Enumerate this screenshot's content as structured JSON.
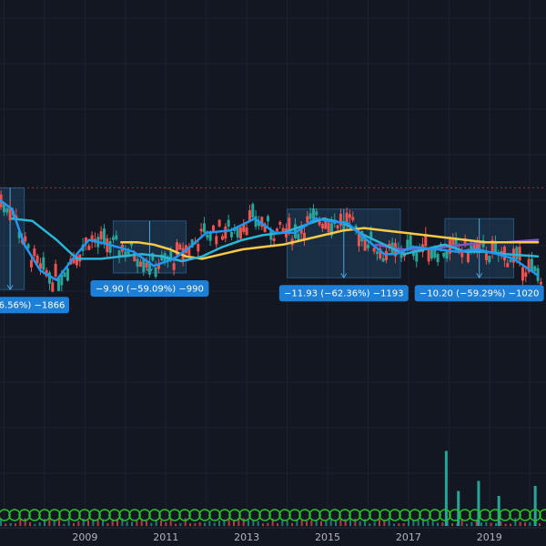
{
  "chart_data": {
    "type": "candlestick",
    "x_tick_labels": [
      "2009",
      "2011",
      "2013",
      "2015",
      "2017",
      "2019"
    ],
    "x_range": [
      2007.0,
      2020.5
    ],
    "y_range_price": [
      0,
      100
    ],
    "grid": true,
    "colors": {
      "background": "#131722",
      "grid": "#1e2230",
      "up": "#26a69a",
      "down": "#ef5350",
      "ma_fast": "#2196f3",
      "ma_mid": "#29b6d8",
      "ma_slow": "#f7c948",
      "ma_long": "#7e57c2",
      "drawdown_box": "#2a6b9c",
      "label_bg": "#1e7fd6",
      "ref_line": "#c0392b",
      "volume": "#26a69a",
      "marker": "#2bbf2b"
    },
    "reference_line": {
      "style": "dotted",
      "value": 86
    },
    "drawdowns": [
      {
        "label": "6.56%) −1866",
        "x_start": 2006.9,
        "x_end": 2007.6,
        "top": 86,
        "bottom": 43
      },
      {
        "label": "−9.90 (−59.09%) −990",
        "x_start": 2009.8,
        "x_end": 2011.6,
        "top": 72,
        "bottom": 50
      },
      {
        "label": "−11.93 (−62.36%) −1193",
        "x_start": 2014.1,
        "x_end": 2016.9,
        "top": 77,
        "bottom": 48
      },
      {
        "label": "−10.20 (−59.29%) −1020",
        "x_start": 2018.0,
        "x_end": 2019.7,
        "top": 73,
        "bottom": 48
      }
    ],
    "series": [
      {
        "type": "ma",
        "x": [
          2006.9,
          2007.3,
          2007.6,
          2008.0,
          2008.4,
          2008.8,
          2009.2,
          2009.7,
          2010.3,
          2010.8,
          2011.3,
          2011.7,
          2012.1,
          2012.7,
          2013.3,
          2013.8,
          2014.3,
          2014.8,
          2015.1,
          2015.6,
          2016.0,
          2016.5,
          2016.8,
          2017.2,
          2017.8,
          2018.3,
          2018.8,
          2019.3,
          2019.7,
          2020.3
        ],
        "y": [
          82,
          77,
          62,
          51,
          47,
          56,
          64,
          62,
          59,
          53,
          56,
          61,
          67,
          68,
          73,
          67,
          67,
          73,
          72,
          71,
          65,
          58,
          58,
          61,
          60,
          59,
          60,
          58,
          56,
          49
        ]
      },
      {
        "type": "ma",
        "x": [
          2007.3,
          2007.8,
          2008.4,
          2008.9,
          2009.5,
          2010.0,
          2010.5,
          2011.0,
          2011.5,
          2012.0,
          2012.5,
          2013.0,
          2013.5,
          2014.0,
          2014.5,
          2015.0,
          2015.5,
          2016.0,
          2016.5,
          2017.0,
          2017.5,
          2018.0,
          2018.5,
          2019.0,
          2019.5,
          2020.3
        ],
        "y": [
          73,
          72,
          64,
          56,
          56,
          57,
          58,
          57,
          55,
          57,
          61,
          64,
          66,
          67,
          70,
          73,
          71,
          66,
          62,
          58,
          60,
          62,
          59,
          59,
          58,
          57
        ]
      },
      {
        "type": "ma",
        "x": [
          2010.0,
          2010.4,
          2010.8,
          2011.2,
          2011.6,
          2012.0,
          2012.5,
          2013.0,
          2013.5,
          2014.0,
          2014.5,
          2015.0,
          2015.5,
          2016.0,
          2016.5,
          2017.0,
          2017.5,
          2018.0,
          2018.5,
          2019.0,
          2019.5,
          2020.3
        ],
        "y": [
          63,
          63,
          62,
          60,
          57,
          56,
          58,
          60,
          61,
          62,
          64,
          66,
          68,
          69,
          68,
          67,
          66,
          65,
          64,
          63,
          63,
          63
        ]
      },
      {
        "type": "ma",
        "x": [
          2016.3,
          2016.9,
          2017.4,
          2018.0,
          2018.5,
          2019.0,
          2019.5,
          2020.3
        ],
        "y": [
          62,
          60,
          60,
          61,
          62,
          63,
          63,
          64
        ]
      }
    ],
    "volume_spikes": [
      {
        "x": 2018.0,
        "v": 75
      },
      {
        "x": 2018.3,
        "v": 35
      },
      {
        "x": 2018.8,
        "v": 45
      },
      {
        "x": 2019.3,
        "v": 30
      },
      {
        "x": 2020.2,
        "v": 40
      }
    ]
  }
}
